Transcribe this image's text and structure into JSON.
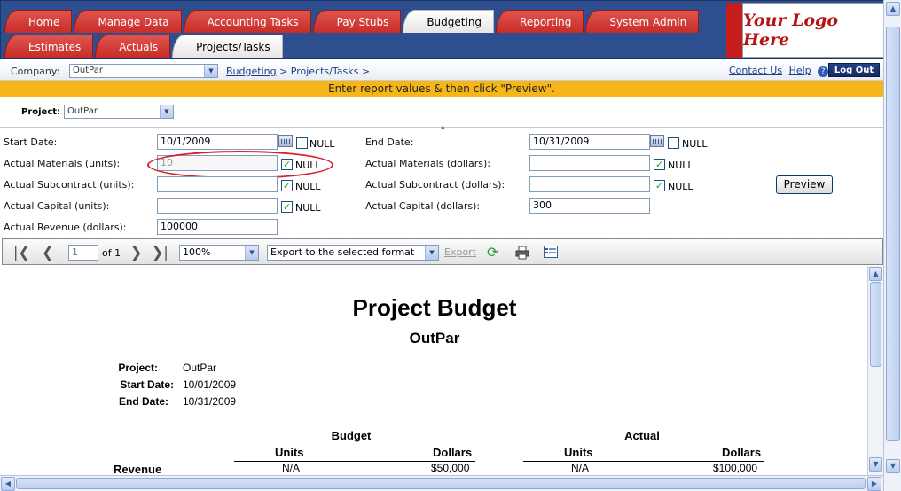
{
  "nav": {
    "tabs_row1": [
      {
        "label": "Home",
        "active": false
      },
      {
        "label": "Manage Data",
        "active": false
      },
      {
        "label": "Accounting Tasks",
        "active": false
      },
      {
        "label": "Pay Stubs",
        "active": false
      },
      {
        "label": "Budgeting",
        "active": true
      },
      {
        "label": "Reporting",
        "active": false
      },
      {
        "label": "System Admin",
        "active": false
      }
    ],
    "tabs_row2": [
      {
        "label": "Estimates",
        "active": false
      },
      {
        "label": "Actuals",
        "active": false
      },
      {
        "label": "Projects/Tasks",
        "active": true
      }
    ]
  },
  "logo": {
    "text": "Your Logo Here"
  },
  "company": {
    "label": "Company:",
    "value": "OutPar",
    "breadcrumb_link": "Budgeting",
    "breadcrumb_rest": " > Projects/Tasks >"
  },
  "toplinks": {
    "contact": "Contact Us",
    "help": "Help",
    "help_glyph": "?",
    "logout": "Log Out"
  },
  "banner": {
    "text": "Enter report values & then click \"Preview\"."
  },
  "project": {
    "label": "Project:",
    "value": "OutPar"
  },
  "params": {
    "null_label": "NULL",
    "start_date": {
      "label": "Start Date:",
      "value": "10/1/2009"
    },
    "end_date": {
      "label": "End Date:",
      "value": "10/31/2009"
    },
    "mat_units": {
      "label": "Actual Materials (units):",
      "value": "10"
    },
    "mat_dollars": {
      "label": "Actual Materials (dollars):",
      "value": ""
    },
    "sub_units": {
      "label": "Actual Subcontract (units):",
      "value": ""
    },
    "sub_dollars": {
      "label": "Actual Subcontract (dollars):",
      "value": ""
    },
    "cap_units": {
      "label": "Actual Capital (units):",
      "value": ""
    },
    "cap_dollars": {
      "label": "Actual Capital (dollars):",
      "value": "300"
    },
    "rev_dollars": {
      "label": "Actual Revenue (dollars):",
      "value": "100000"
    }
  },
  "preview": {
    "label": "Preview"
  },
  "toolbar": {
    "page": "1",
    "of": "of 1",
    "zoom": "100%",
    "export_format": "Export to the selected format",
    "export_link": "Export",
    "first_glyph": "|❮",
    "prev_glyph": "❮",
    "next_glyph": "❯",
    "last_glyph": "❯|"
  },
  "report": {
    "title": "Project Budget",
    "subtitle": "OutPar",
    "project_label": "Project:",
    "project_value": "OutPar",
    "start_label": "Start Date:",
    "start_value": "10/01/2009",
    "end_label": "End Date:",
    "end_value": "10/31/2009",
    "budget_header": "Budget",
    "actual_header": "Actual",
    "units_header": "Units",
    "dollars_header": "Dollars",
    "row_label": "Revenue",
    "budget_units": "N/A",
    "budget_dollars": "$50,000",
    "actual_units": "N/A",
    "actual_dollars": "$100,000"
  },
  "colors": {
    "nav_blue": "#2e4f8f",
    "tab_red": "#c82c28",
    "banner": "#f6b617",
    "highlight": "#d8202a"
  }
}
